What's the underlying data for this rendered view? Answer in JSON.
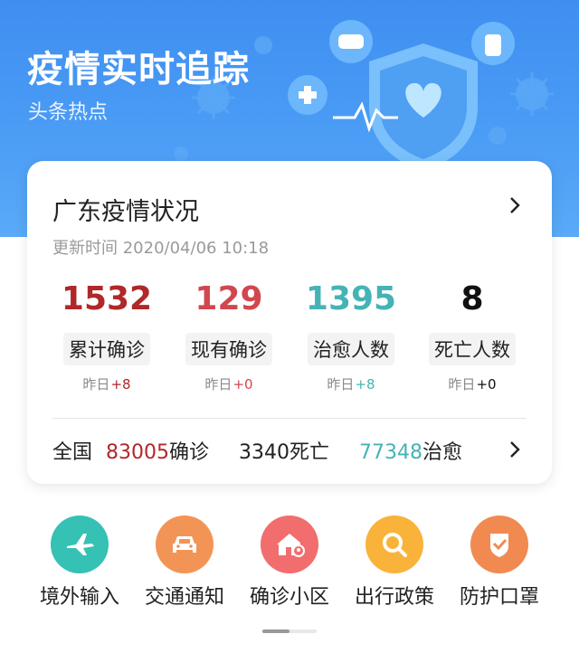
{
  "header": {
    "title": "疫情实时追踪",
    "subtitle": "头条热点"
  },
  "card": {
    "title": "广东疫情状况",
    "update_time": "更新时间 2020/04/06 10:18",
    "stats": [
      {
        "value": "1532",
        "label": "累计确诊",
        "delta_prefix": "昨日",
        "delta": "+8",
        "color": "#b0282a",
        "delta_color": "#b0282a"
      },
      {
        "value": "129",
        "label": "现有确诊",
        "delta_prefix": "昨日",
        "delta": "+0",
        "color": "#d2474f",
        "delta_color": "#d2474f"
      },
      {
        "value": "1395",
        "label": "治愈人数",
        "delta_prefix": "昨日",
        "delta": "+8",
        "color": "#45b3b6",
        "delta_color": "#45b3b6"
      },
      {
        "value": "8",
        "label": "死亡人数",
        "delta_prefix": "昨日",
        "delta": "+0",
        "color": "#111111",
        "delta_color": "#111111"
      }
    ],
    "national": {
      "label": "全国",
      "confirmed_value": "83005",
      "confirmed_label": "确诊",
      "deaths_value": "3340",
      "deaths_label": "死亡",
      "cured_value": "77348",
      "cured_label": "治愈"
    }
  },
  "features": [
    {
      "label": "境外输入",
      "icon": "airplane-icon",
      "color": "#35c1b4"
    },
    {
      "label": "交通通知",
      "icon": "car-icon",
      "color": "#f39457"
    },
    {
      "label": "确诊小区",
      "icon": "house-location-icon",
      "color": "#f26d6d"
    },
    {
      "label": "出行政策",
      "icon": "search-icon",
      "color": "#f9b33a"
    },
    {
      "label": "防护口罩",
      "icon": "shield-check-icon",
      "color": "#f18a50"
    }
  ],
  "colors": {
    "banner": "#4a9cf5",
    "national_confirmed": "#b0282a",
    "national_cured": "#45b3b6"
  }
}
